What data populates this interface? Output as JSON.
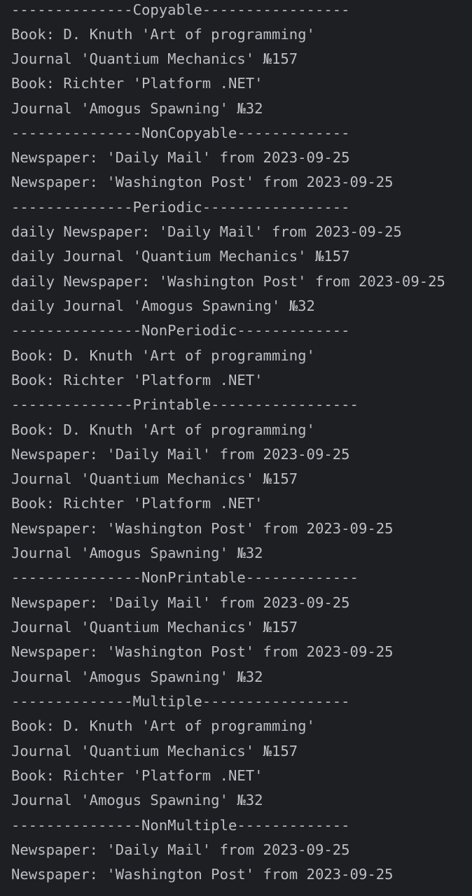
{
  "console": {
    "background": "#1e1f22",
    "text_color": "#bcbec4",
    "lines": [
      "--------------Copyable-----------------",
      "Book: D. Knuth 'Art of programming'",
      "Journal 'Quantium Mechanics' №157",
      "Book: Richter 'Platform .NET'",
      "Journal 'Amogus Spawning' №32",
      "---------------NonCopyable-------------",
      "Newspaper: 'Daily Mail' from 2023-09-25",
      "Newspaper: 'Washington Post' from 2023-09-25",
      "--------------Periodic-----------------",
      "daily Newspaper: 'Daily Mail' from 2023-09-25",
      "daily Journal 'Quantium Mechanics' №157",
      "daily Newspaper: 'Washington Post' from 2023-09-25",
      "daily Journal 'Amogus Spawning' №32",
      "---------------NonPeriodic-------------",
      "Book: D. Knuth 'Art of programming'",
      "Book: Richter 'Platform .NET'",
      "--------------Printable-----------------",
      "Book: D. Knuth 'Art of programming'",
      "Newspaper: 'Daily Mail' from 2023-09-25",
      "Journal 'Quantium Mechanics' №157",
      "Book: Richter 'Platform .NET'",
      "Newspaper: 'Washington Post' from 2023-09-25",
      "Journal 'Amogus Spawning' №32",
      "---------------NonPrintable-------------",
      "Newspaper: 'Daily Mail' from 2023-09-25",
      "Journal 'Quantium Mechanics' №157",
      "Newspaper: 'Washington Post' from 2023-09-25",
      "Journal 'Amogus Spawning' №32",
      "--------------Multiple-----------------",
      "Book: D. Knuth 'Art of programming'",
      "Journal 'Quantium Mechanics' №157",
      "Book: Richter 'Platform .NET'",
      "Journal 'Amogus Spawning' №32",
      "---------------NonMultiple-------------",
      "Newspaper: 'Daily Mail' from 2023-09-25",
      "Newspaper: 'Washington Post' from 2023-09-25"
    ]
  }
}
